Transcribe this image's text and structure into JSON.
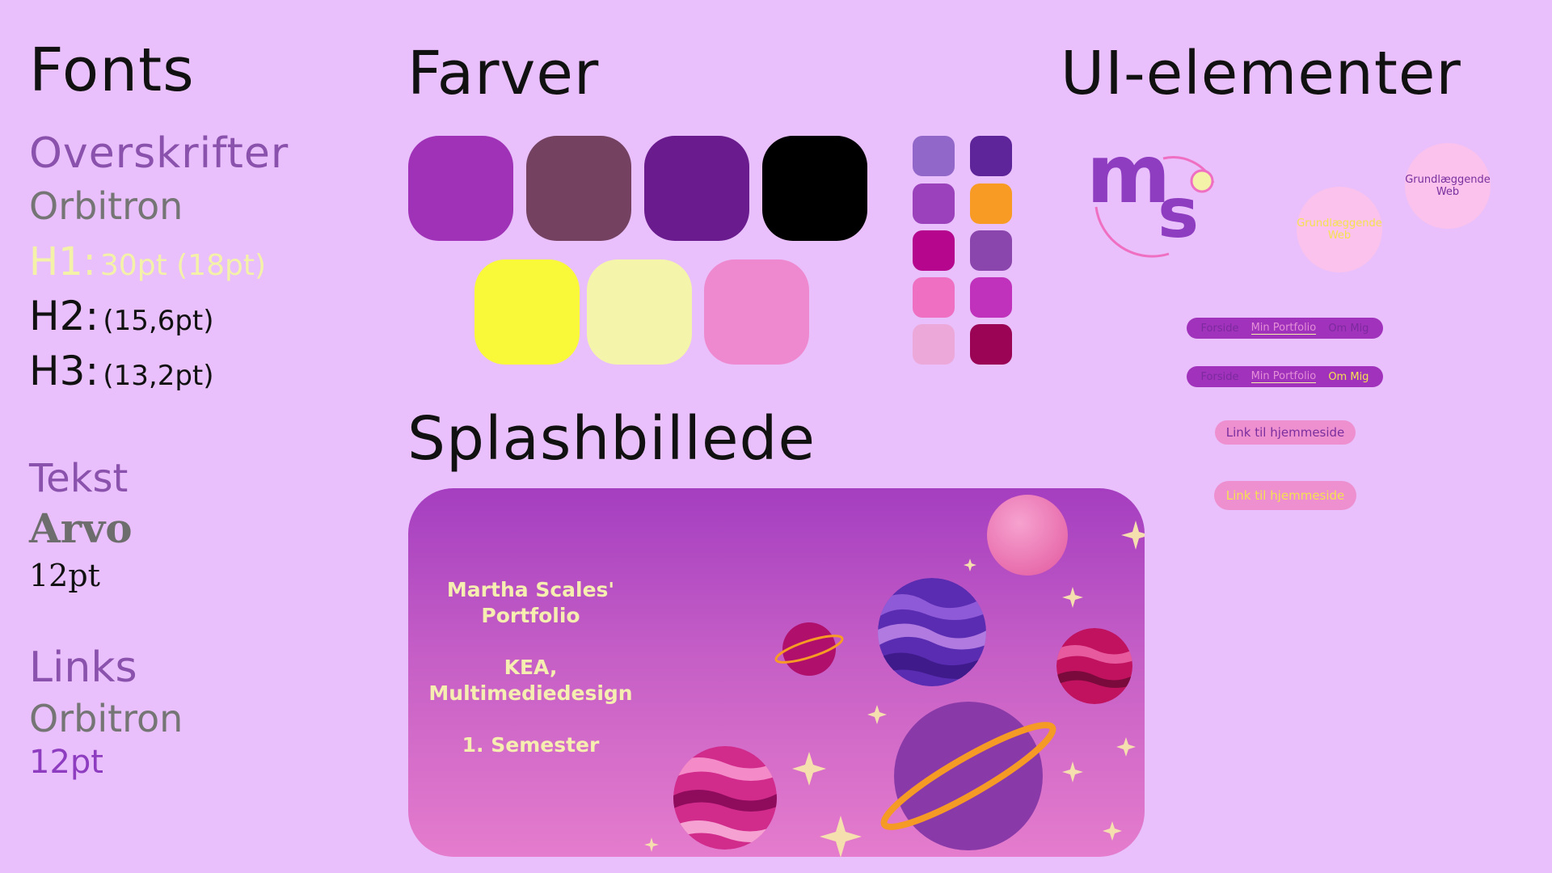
{
  "fonts": {
    "title": "Fonts",
    "headings_label": "Overskrifter",
    "headings_font": "Orbitron",
    "h1": "H1:",
    "h1_size": "30pt (18pt)",
    "h2": "H2:",
    "h2_size": "(15,6pt)",
    "h3": "H3:",
    "h3_size": "(13,2pt)",
    "text_label": "Tekst",
    "text_font": "Arvo",
    "text_size": "12pt",
    "links_label": "Links",
    "links_font": "Orbitron",
    "links_size": "12pt"
  },
  "colors": {
    "title": "Farver",
    "large_swatches": [
      "#a032b8",
      "#744161",
      "#6a1b8e",
      "#000000",
      "#f9f93a",
      "#f4f4aa",
      "#ef89cf"
    ],
    "small_swatches": [
      "#9167c9",
      "#5e2499",
      "#9a41bb",
      "#f79b25",
      "#b5068d",
      "#8b46ad",
      "#ef70c2",
      "#c032bb",
      "#eda8da",
      "#9b0355"
    ]
  },
  "splash": {
    "title": "Splashbillede",
    "line1": "Martha Scales'",
    "line2": "Portfolio",
    "line3": "KEA,",
    "line4": "Multimediedesign",
    "line5": "1. Semester"
  },
  "ui": {
    "title": "UI-elementer",
    "logo_m": "m",
    "logo_s": "s",
    "circle_button_1": "Grundlæggende Web",
    "circle_button_2": "Grundlæggende Web",
    "nav1": [
      "Forside",
      "Min Portfolio",
      "Om Mig"
    ],
    "nav2": [
      "Forside",
      "Min Portfolio",
      "Om Mig"
    ],
    "link1": "Link til hjemmeside",
    "link2": "Link til hjemmeside"
  }
}
